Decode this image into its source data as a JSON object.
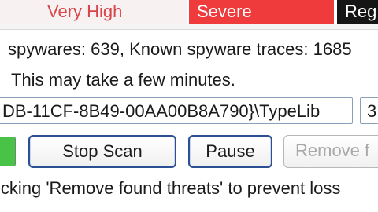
{
  "severity_row": {
    "very_high": "Very High",
    "severe": "Severe",
    "reg": "Reg"
  },
  "status": {
    "stats_line": "spywares: 639, Known spyware traces: 1685",
    "note": "This may take a few minutes."
  },
  "scan": {
    "current_item": "DB-11CF-8B49-00AA00B8A790}\\TypeLib",
    "side_value": "3"
  },
  "buttons": {
    "stop_scan": "Stop Scan",
    "pause": "Pause",
    "remove": "Remove f"
  },
  "hint": "icking 'Remove found threats' to prevent loss",
  "colors": {
    "very_high_text": "#d8464a",
    "severe_bg": "#ef3b3b",
    "reg_bg": "#151515",
    "progress": "#48c348",
    "button_border": "#2a4f93"
  }
}
